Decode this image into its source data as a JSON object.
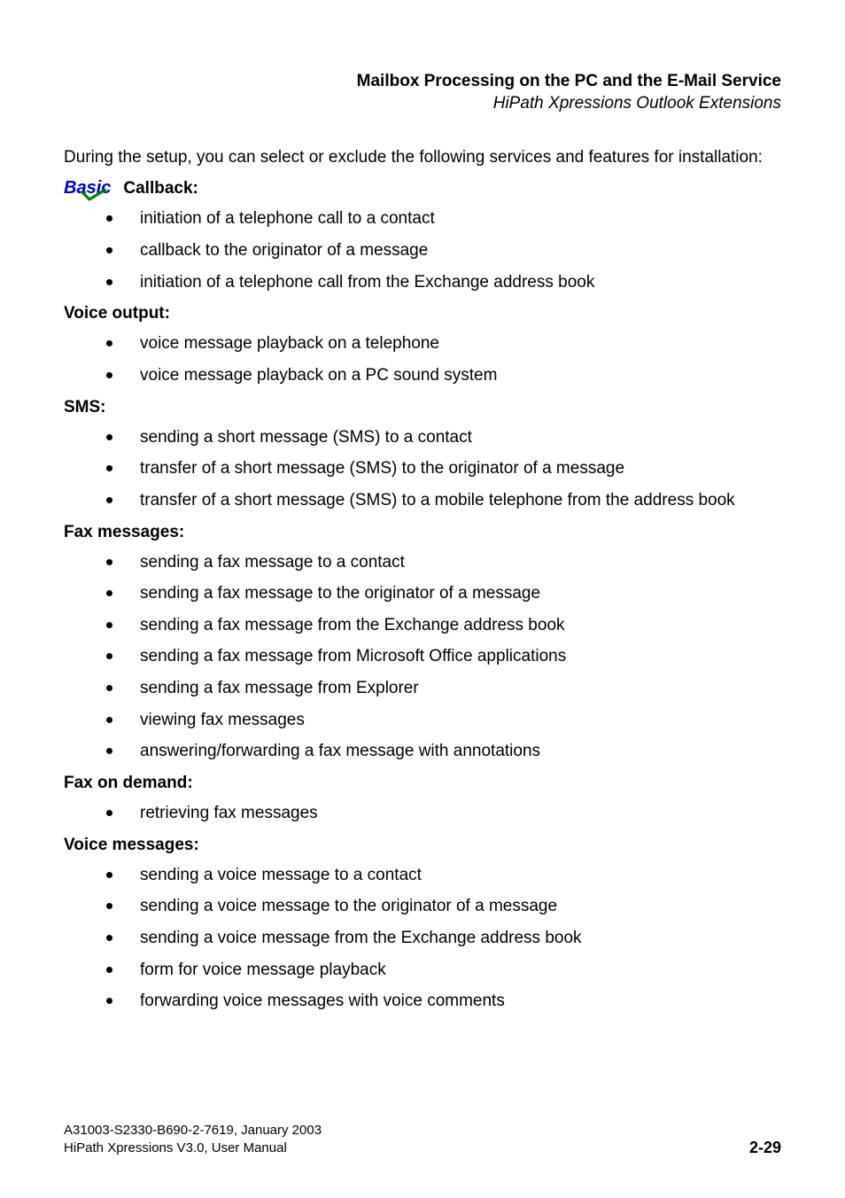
{
  "header": {
    "title": "Mailbox Processing on the PC and the E-Mail Service",
    "subtitle": "HiPath Xpressions Outlook Extensions"
  },
  "intro": "During the setup, you can select or exclude the following services and features for installation:",
  "sections": [
    {
      "basicTag": "Basic",
      "title": "Callback:",
      "items": [
        "initiation of a telephone call to a contact",
        "callback to the originator of a message",
        "initiation of a telephone call from the Exchange address book"
      ]
    },
    {
      "title": "Voice output:",
      "items": [
        "voice message playback on a telephone",
        "voice message playback on a PC sound system"
      ]
    },
    {
      "title": "SMS:",
      "items": [
        "sending a short message (SMS) to a contact",
        "transfer of a short message (SMS) to the originator of a message",
        "transfer of a short message (SMS) to a mobile telephone from the address book"
      ]
    },
    {
      "title": "Fax messages:",
      "items": [
        "sending a fax message to a contact",
        "sending a fax message to the originator of a message",
        "sending a fax message from the Exchange address book",
        "sending a fax message from Microsoft Office applications",
        "sending a fax message from Explorer",
        "viewing fax messages",
        "answering/forwarding a fax message with annotations"
      ]
    },
    {
      "title": "Fax on demand:",
      "items": [
        "retrieving fax messages"
      ]
    },
    {
      "title": "Voice messages:",
      "items": [
        "sending a voice message to a contact",
        "sending a voice message to the originator of a message",
        "sending a voice message from the Exchange address book",
        "form for voice message playback",
        "forwarding voice messages with voice comments"
      ]
    }
  ],
  "footer": {
    "line1": "A31003-S2330-B690-2-7619, January 2003",
    "line2": "HiPath Xpressions V3.0, User Manual",
    "pageNum": "2-29"
  }
}
